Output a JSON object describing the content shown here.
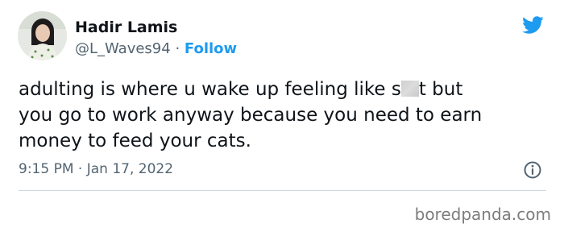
{
  "author": {
    "display_name": "Hadir Lamis",
    "handle": "@L_Waves94",
    "separator": " · ",
    "follow_label": "Follow"
  },
  "tweet": {
    "lines": [
      {
        "before": "adulting is where u wake up feeling like s",
        "after": "t but"
      },
      {
        "text": "you go to work anyway because you need to earn"
      },
      {
        "text": "money to feed your cats."
      }
    ],
    "time": "9:15 PM",
    "separator": " · ",
    "date": "Jan 17, 2022"
  },
  "icons": {
    "brand": "twitter-bird-icon",
    "info": "info-icon",
    "brand_color": "#1d9bf0"
  },
  "watermark": "boredpanda.com"
}
